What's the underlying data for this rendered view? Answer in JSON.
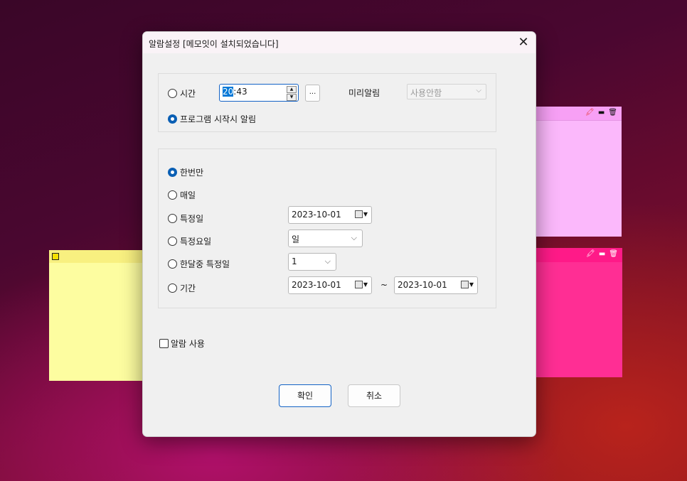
{
  "dialog": {
    "title": "알람설정 [메모잇이 설치되었습니다]",
    "close_glyph": "✕"
  },
  "time_group": {
    "radio_time": "시간",
    "radio_program": "프로그램 시작시 알림",
    "selected": "program",
    "time_hour": "20",
    "time_rest": ":43",
    "dots_label": "...",
    "pre_alarm_label": "미리알림",
    "pre_alarm_value": "사용안함"
  },
  "repeat_group": {
    "selected": "once",
    "once": "한번만",
    "daily": "매일",
    "specific_date": "특정일",
    "specific_date_value": "2023-10-01",
    "weekday": "특정요일",
    "weekday_value": "일",
    "monthly": "한달중 특정일",
    "monthly_value": "1",
    "period": "기간",
    "period_start": "2023-10-01",
    "period_tilde": "~",
    "period_end": "2023-10-01"
  },
  "enable_alarm": {
    "label": "알람 사용",
    "checked": false
  },
  "buttons": {
    "ok": "확인",
    "cancel": "취소"
  },
  "colors": {
    "accent": "#0a5fb4",
    "note_yellow": "#fdfda0",
    "note_lilac": "#fbb8fb",
    "note_pink": "#ff2e94"
  }
}
